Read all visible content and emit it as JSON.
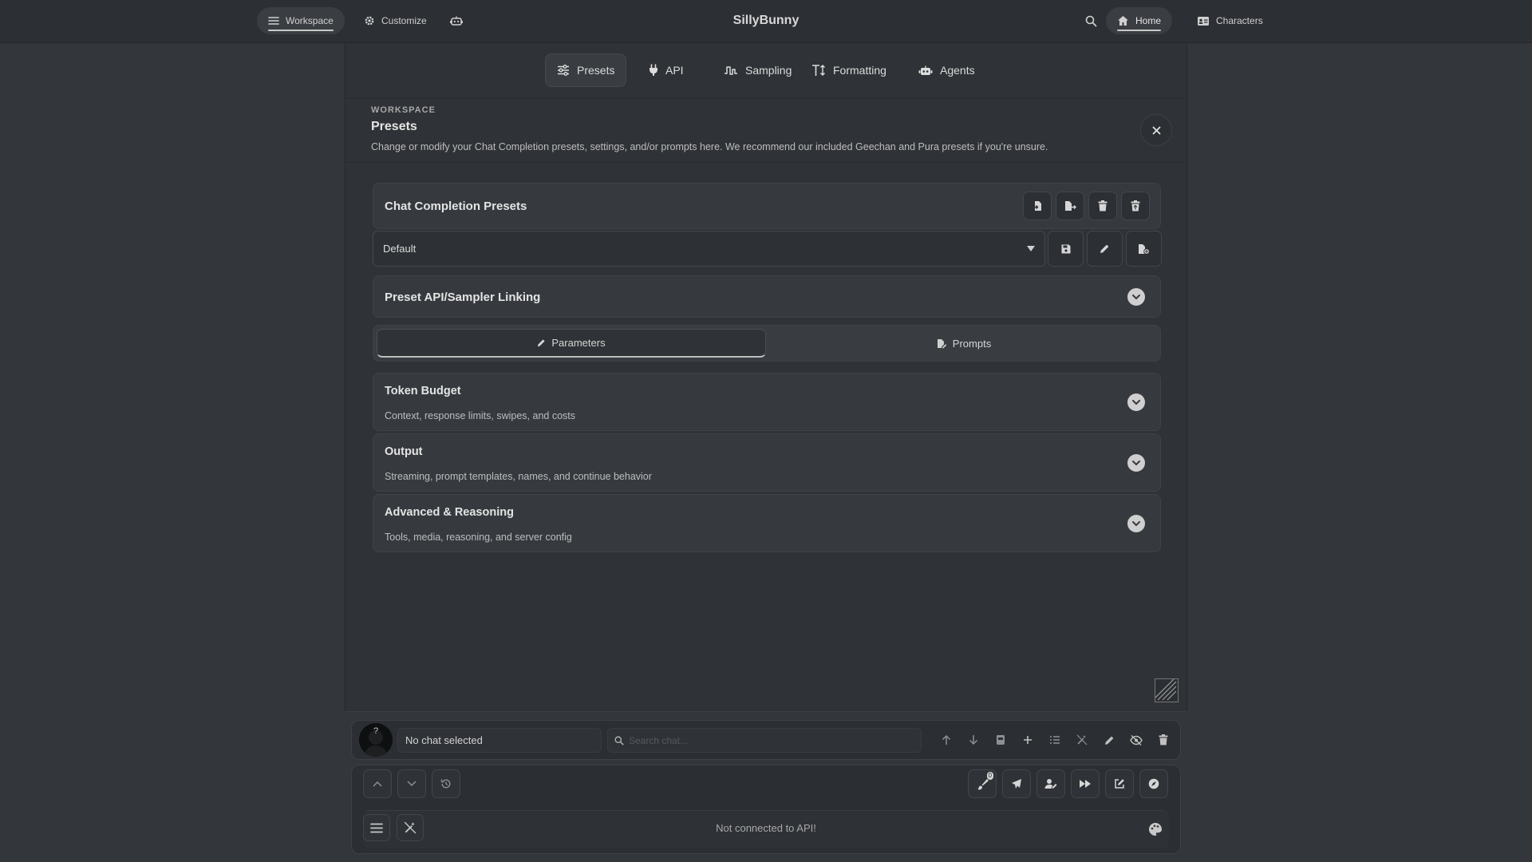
{
  "topbar": {
    "workspace_label": "Workspace",
    "customize_label": "Customize",
    "app_title": "SillyBunny",
    "home_label": "Home",
    "characters_label": "Characters"
  },
  "tabs": [
    {
      "label": "Presets",
      "icon": "sliders-icon",
      "active": true
    },
    {
      "label": "API",
      "icon": "plug-icon",
      "active": false
    },
    {
      "label": "Sampling",
      "icon": "waveform-icon",
      "active": false
    },
    {
      "label": "Formatting",
      "icon": "text-height-icon",
      "active": false
    },
    {
      "label": "Agents",
      "icon": "robot-icon",
      "active": false
    }
  ],
  "section": {
    "eyebrow": "WORKSPACE",
    "title": "Presets",
    "description": "Change or modify your Chat Completion presets, settings, and/or prompts here. We recommend our included Geechan and Pura presets if you're unsure."
  },
  "presets_card": {
    "title": "Chat Completion Presets",
    "selected": "Default"
  },
  "linking": {
    "title": "Preset API/Sampler Linking"
  },
  "segments": {
    "parameters": "Parameters",
    "prompts": "Prompts"
  },
  "groups": [
    {
      "title": "Token Budget",
      "subtitle": "Context, response limits, swipes, and costs"
    },
    {
      "title": "Output",
      "subtitle": "Streaming, prompt templates, names, and continue behavior"
    },
    {
      "title": "Advanced & Reasoning",
      "subtitle": "Tools, media, reasoning, and server config"
    }
  ],
  "chatbar": {
    "chat_name": "No chat selected",
    "search_placeholder": "Search chat..."
  },
  "dock": {
    "badge_count": "0",
    "status": "Not connected to API!"
  },
  "colors": {
    "background": "#33363b",
    "panel": "#2f3236",
    "card": "#363a3f",
    "text": "#d6d6d6"
  }
}
